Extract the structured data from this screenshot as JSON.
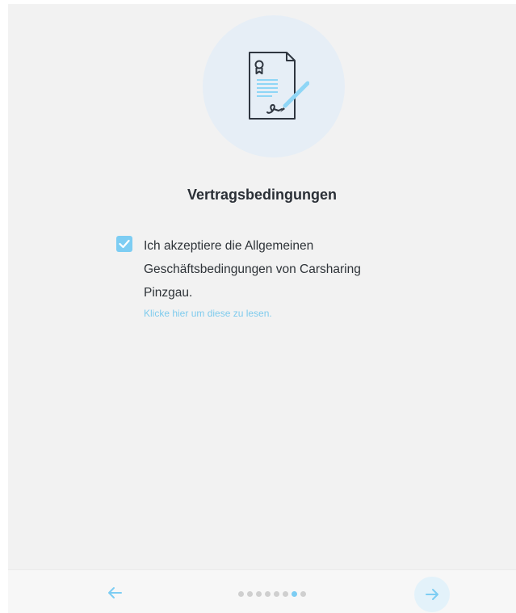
{
  "step": {
    "title": "Vertragsbedingungen",
    "illustration_icon": "contract-signing-icon"
  },
  "consent": {
    "checked": true,
    "text": "Ich akzeptiere die Allgemeinen Geschäftsbedingungen von Carsharing Pinzgau.",
    "link_text": "Klicke hier um diese zu lesen."
  },
  "navigation": {
    "back_icon": "arrow-left-icon",
    "next_icon": "arrow-right-icon",
    "total_steps": 8,
    "current_step": 7
  },
  "colors": {
    "accent": "#7dcdf3",
    "panel_background": "#f2f2f2",
    "hero_circle": "#e6eef6",
    "inactive_dot": "#cfcfcf"
  }
}
